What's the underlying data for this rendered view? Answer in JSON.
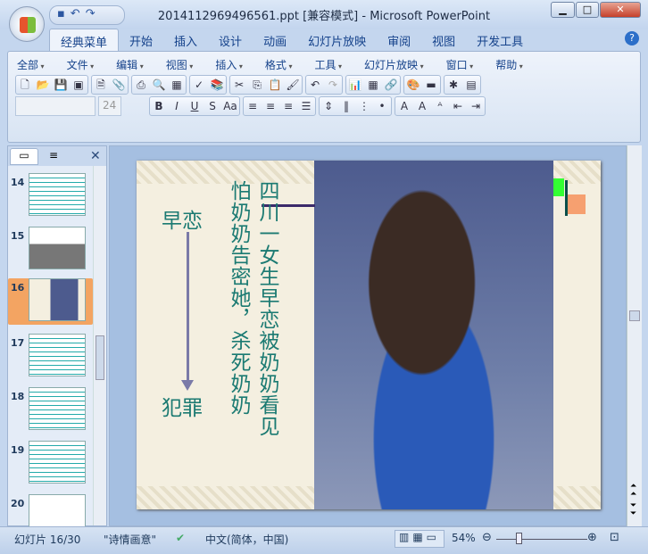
{
  "window": {
    "title": "2014112969496561.ppt [兼容模式] - Microsoft PowerPoint",
    "minimize": "▁",
    "maximize": "□",
    "close": "✕"
  },
  "qat": "▪↶↷",
  "tabs": [
    "经典菜单",
    "开始",
    "插入",
    "设计",
    "动画",
    "幻灯片放映",
    "审阅",
    "视图",
    "开发工具"
  ],
  "help": "?",
  "menus": [
    "全部",
    "文件",
    "编辑",
    "视图",
    "插入",
    "格式",
    "工具",
    "幻灯片放映",
    "窗口",
    "帮助"
  ],
  "font": {
    "name": "",
    "size": "24"
  },
  "format_buttons": [
    "B",
    "I",
    "U",
    "S",
    "Aa"
  ],
  "thumbs": [
    "14",
    "15",
    "16",
    "17",
    "18",
    "19",
    "20"
  ],
  "selected_slide": "16",
  "slide": {
    "left_top": "早恋",
    "left_bottom": "犯罪",
    "col1": "四川一女生早恋被奶奶看见",
    "col2": "怕奶奶告密她，杀死奶奶"
  },
  "status": {
    "slide": "幻灯片 16/30",
    "theme": "\"诗情画意\"",
    "lang": "中文(简体，中国)",
    "zoom": "54%",
    "zoom_value": 54
  }
}
